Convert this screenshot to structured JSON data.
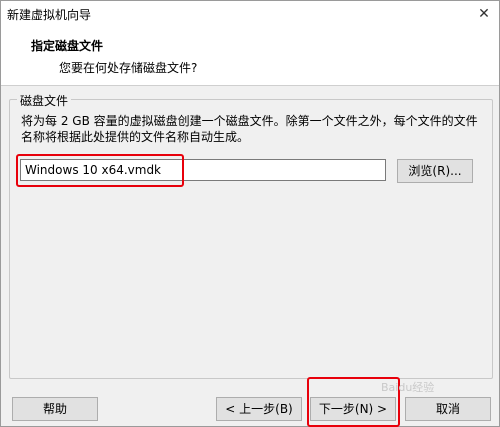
{
  "window": {
    "title": "新建虚拟机向导",
    "close_label": "✕"
  },
  "header": {
    "title": "指定磁盘文件",
    "subtitle": "您要在何处存储磁盘文件?"
  },
  "group": {
    "label": "磁盘文件",
    "description": "将为每 2 GB 容量的虚拟磁盘创建一个磁盘文件。除第一个文件之外，每个文件的文件名称将根据此处提供的文件名称自动生成。",
    "file_value": "Windows 10 x64.vmdk",
    "browse_label": "浏览(R)..."
  },
  "footer": {
    "help_label": "帮助",
    "back_label": "< 上一步(B)",
    "next_label": "下一步(N) >",
    "cancel_label": "取消"
  },
  "watermark": "Baidu经验",
  "colors": {
    "highlight": "#e8000b"
  }
}
